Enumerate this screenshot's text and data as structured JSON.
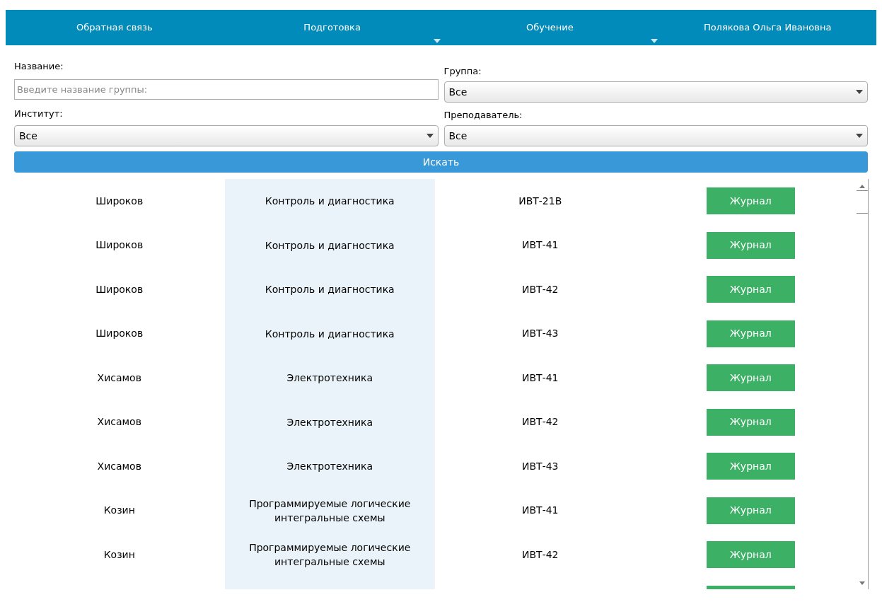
{
  "nav": [
    {
      "label": "Обратная связь",
      "dropdown": false
    },
    {
      "label": "Подготовка",
      "dropdown": true
    },
    {
      "label": "Обучение",
      "dropdown": true
    },
    {
      "label": "Полякова Ольга Ивановна",
      "dropdown": false
    }
  ],
  "filters": {
    "name": {
      "label": "Название:",
      "placeholder": "Введите название группы:"
    },
    "group": {
      "label": "Группа:",
      "value": "Все"
    },
    "institute": {
      "label": "Институт:",
      "value": "Все"
    },
    "teacher": {
      "label": "Преподаватель:",
      "value": "Все"
    },
    "search_button": "Искать"
  },
  "rows": [
    {
      "teacher": "Широков",
      "subject": "Контроль и диагностика",
      "group": "ИВТ-21В",
      "action": "Журнал"
    },
    {
      "teacher": "Широков",
      "subject": "Контроль и диагностика",
      "group": "ИВТ-41",
      "action": "Журнал"
    },
    {
      "teacher": "Широков",
      "subject": "Контроль и диагностика",
      "group": "ИВТ-42",
      "action": "Журнал"
    },
    {
      "teacher": "Широков",
      "subject": "Контроль и диагностика",
      "group": "ИВТ-43",
      "action": "Журнал"
    },
    {
      "teacher": "Хисамов",
      "subject": "Электротехника",
      "group": "ИВТ-41",
      "action": "Журнал"
    },
    {
      "teacher": "Хисамов",
      "subject": "Электротехника",
      "group": "ИВТ-42",
      "action": "Журнал"
    },
    {
      "teacher": "Хисамов",
      "subject": "Электротехника",
      "group": "ИВТ-43",
      "action": "Журнал"
    },
    {
      "teacher": "Козин",
      "subject": "Программируемые логические интегральные схемы",
      "group": "ИВТ-41",
      "action": "Журнал"
    },
    {
      "teacher": "Козин",
      "subject": "Программируемые логические интегральные схемы",
      "group": "ИВТ-42",
      "action": "Журнал"
    }
  ]
}
